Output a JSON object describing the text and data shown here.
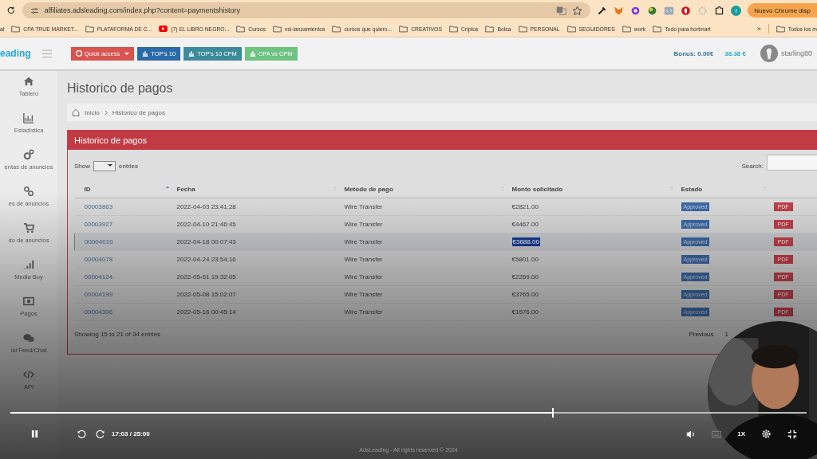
{
  "browser": {
    "url": "affiliates.adsleading.com/index.php?content=paymentshistory",
    "profile_initial": "r",
    "update_button": "Nuevo Chrome disp",
    "bookmarks": [
      {
        "label": "al",
        "kind": "text"
      },
      {
        "label": "CPA TRUE MARKET...",
        "kind": "folder"
      },
      {
        "label": "PLATAFORMA DE C...",
        "kind": "folder"
      },
      {
        "label": "(7) EL LIBRO NEGRO...",
        "kind": "video"
      },
      {
        "label": "Cursos",
        "kind": "folder"
      },
      {
        "label": "vsl-lanzamientos",
        "kind": "folder"
      },
      {
        "label": "cursos que quiero...",
        "kind": "folder"
      },
      {
        "label": "CREATIVOS",
        "kind": "folder"
      },
      {
        "label": "Criptos",
        "kind": "folder"
      },
      {
        "label": "Bolsa",
        "kind": "folder"
      },
      {
        "label": "PERSONAL",
        "kind": "folder"
      },
      {
        "label": "SEGUIDORES",
        "kind": "folder"
      },
      {
        "label": "work",
        "kind": "folder"
      },
      {
        "label": "Todo para hortmart",
        "kind": "folder"
      }
    ],
    "more": "»",
    "all_bookmarks": "Todos los m"
  },
  "header": {
    "logo": "eading",
    "buttons": [
      {
        "label": "Quick access",
        "color": "#d9534f",
        "dropdown": true
      },
      {
        "label": "TOP's 10",
        "color": "#2a6aa8",
        "dropdown": false
      },
      {
        "label": "TOP's 10 CPM",
        "color": "#3d8a9a",
        "dropdown": false
      },
      {
        "label": "CPA vs CPM",
        "color": "#6ec383",
        "dropdown": false
      }
    ],
    "bonus": "Bonus: 0.00€",
    "balance": "38.38 €",
    "user": "starling80"
  },
  "sidebar": {
    "items": [
      {
        "label": "Tablero"
      },
      {
        "label": "Estadística"
      },
      {
        "label": "entas de anuncios"
      },
      {
        "label": "es de anuncios"
      },
      {
        "label": "do de anuncios"
      },
      {
        "label": "Media Buy"
      },
      {
        "label": "Pagos"
      },
      {
        "label": "ial Feed/Chat"
      },
      {
        "label": "API"
      }
    ]
  },
  "page": {
    "title": "Historico de pagos",
    "breadcrumb": [
      "Inicio",
      "Historico de pagos"
    ]
  },
  "panel": {
    "title": "Historico de pagos",
    "show_label": "Show",
    "entries_label": "entries",
    "search_label": "Search:",
    "columns": [
      {
        "label": "ID",
        "sorted": true
      },
      {
        "label": "Fecha",
        "sorted": false
      },
      {
        "label": "Metodo de pago",
        "sorted": false
      },
      {
        "label": "Monto solicitado",
        "sorted": false
      },
      {
        "label": "Estado",
        "sorted": false
      }
    ],
    "rows": [
      {
        "id": "00003863",
        "date": "2022-04-03 23:41:28",
        "method": "Wire Transfer",
        "amount": "€2821.00",
        "status": "Approved",
        "action": "PDF",
        "selected": false,
        "amount_highlighted": false
      },
      {
        "id": "00003927",
        "date": "2022-04-10 21:46:45",
        "method": "Wire Transfer",
        "amount": "€4467.00",
        "status": "Approved",
        "action": "PDF",
        "selected": false,
        "amount_highlighted": false
      },
      {
        "id": "00004010",
        "date": "2022-04-18 00:07:43",
        "method": "Wire Transfer",
        "amount": "€3688.00",
        "status": "Approved",
        "action": "PDF",
        "selected": true,
        "amount_highlighted": true
      },
      {
        "id": "00004078",
        "date": "2022-04-24 23:54:16",
        "method": "Wire Transfer",
        "amount": "€5801.00",
        "status": "Approved",
        "action": "PDF",
        "selected": false,
        "amount_highlighted": false
      },
      {
        "id": "00004124",
        "date": "2022-05-01 19:32:05",
        "method": "Wire Transfer",
        "amount": "€2269.00",
        "status": "Approved",
        "action": "PDF",
        "selected": false,
        "amount_highlighted": false
      },
      {
        "id": "00004199",
        "date": "2022-05-08 15:02:07",
        "method": "Wire Transfer",
        "amount": "€3765.00",
        "status": "Approved",
        "action": "PDF",
        "selected": false,
        "amount_highlighted": false
      },
      {
        "id": "00004306",
        "date": "2022-05-16 00:45:14",
        "method": "Wire Transfer",
        "amount": "€1576.00",
        "status": "Approved",
        "action": "PDF",
        "selected": false,
        "amount_highlighted": false
      }
    ],
    "info": "Showing 15 to 21 of 34 entries",
    "pagination": {
      "previous": "Previous",
      "page": "1"
    }
  },
  "footer": "AdsLeading - All rights reserved © 2024",
  "video": {
    "playing": true,
    "level": 0.68,
    "time": "17:03 / 25:00",
    "speed": "1X"
  }
}
